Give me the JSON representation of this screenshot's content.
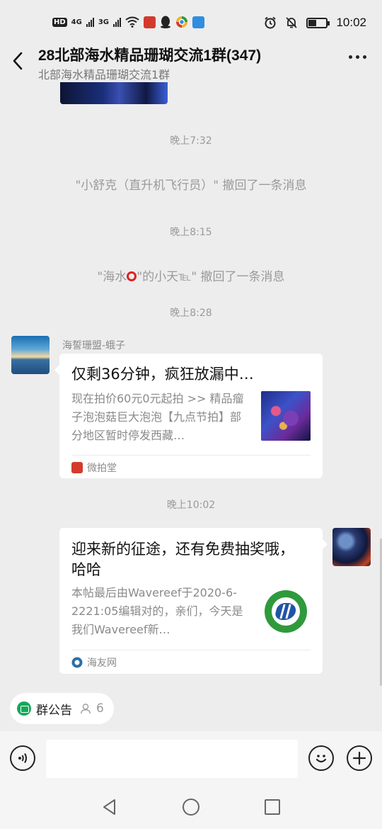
{
  "status_bar": {
    "network_hd": "HD",
    "network_4g": "4G",
    "network_3g": "3G",
    "time": "10:02",
    "colors": {
      "app1": "#d33a2c",
      "app3": "#2f8ee0"
    }
  },
  "header": {
    "title": "28北部海水精品珊瑚交流1群(347)",
    "subtitle": "北部海水精品珊瑚交流1群",
    "back_icon": "chevron-left-icon",
    "more_icon": "more-dots-icon"
  },
  "messages": {
    "time1": "晚上7:32",
    "recall1": "\"小舒克（直升机飞行员）\" 撤回了一条消息",
    "time2": "晚上8:15",
    "recall2_before": "\"海水",
    "recall2_after": "\"的小天℡\" 撤回了一条消息",
    "time3": "晚上8:28",
    "sender": "海誓珊盟-蛾子",
    "card1": {
      "title": "仅剩36分钟，疯狂放漏中…",
      "description": "现在拍价60元0元起拍 >> 精品瘤子泡泡菇巨大泡泡【九点节拍】部分地区暂时停发西藏…",
      "source": "微拍堂",
      "source_color": "#d33a2c"
    },
    "time4": "晚上10:02",
    "card2": {
      "title": "迎来新的征途，还有免费抽奖哦，哈哈",
      "description": "本帖最后由Wavereef于2020-6-2221:05编辑对的，亲们，今天是我们Wavereef新…",
      "source": "海友网",
      "source_color": "#2a6fa8"
    }
  },
  "notice_bar": {
    "label": "群公告",
    "member_count": "6",
    "accent": "#16a85a"
  },
  "input_bar": {
    "voice_icon": "voice-icon",
    "emoji_icon": "emoji-icon",
    "plus_icon": "plus-icon",
    "placeholder": ""
  },
  "nav_bar": {
    "back": "triangle-back-icon",
    "home": "circle-home-icon",
    "recent": "square-recent-icon"
  }
}
